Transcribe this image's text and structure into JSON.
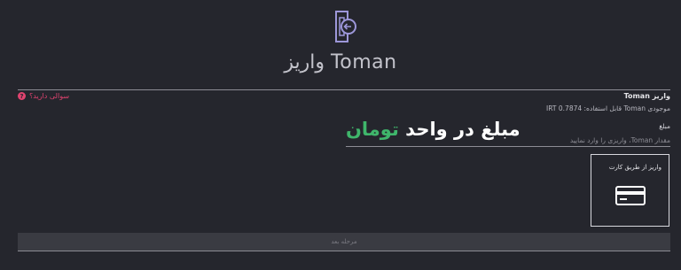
{
  "header": {
    "icon": "wallet-arrow-icon",
    "title": "واریز Toman"
  },
  "help": {
    "icon": "question-icon",
    "label": "سوالی دارید؟"
  },
  "form": {
    "heading": "واریز Toman",
    "balance": "موجودی Toman قابل استفاده: IRT 0.7874",
    "amount_label": "مبلغ",
    "amount_value": "",
    "amount_placeholder": "مقدار Toman، واریزی را وارد نمایید"
  },
  "overlay": {
    "prefix": "مبلغ در واحد ",
    "accent": "تومان"
  },
  "payment_method": {
    "label": "واریز از طریق کارت",
    "icon": "credit-card-icon"
  },
  "next_button": {
    "label": "مرحله بعد"
  },
  "colors": {
    "background": "#25262d",
    "danger": "#e0436f",
    "accent_green": "#3fb66b",
    "icon_purple": "#9d97d9"
  }
}
